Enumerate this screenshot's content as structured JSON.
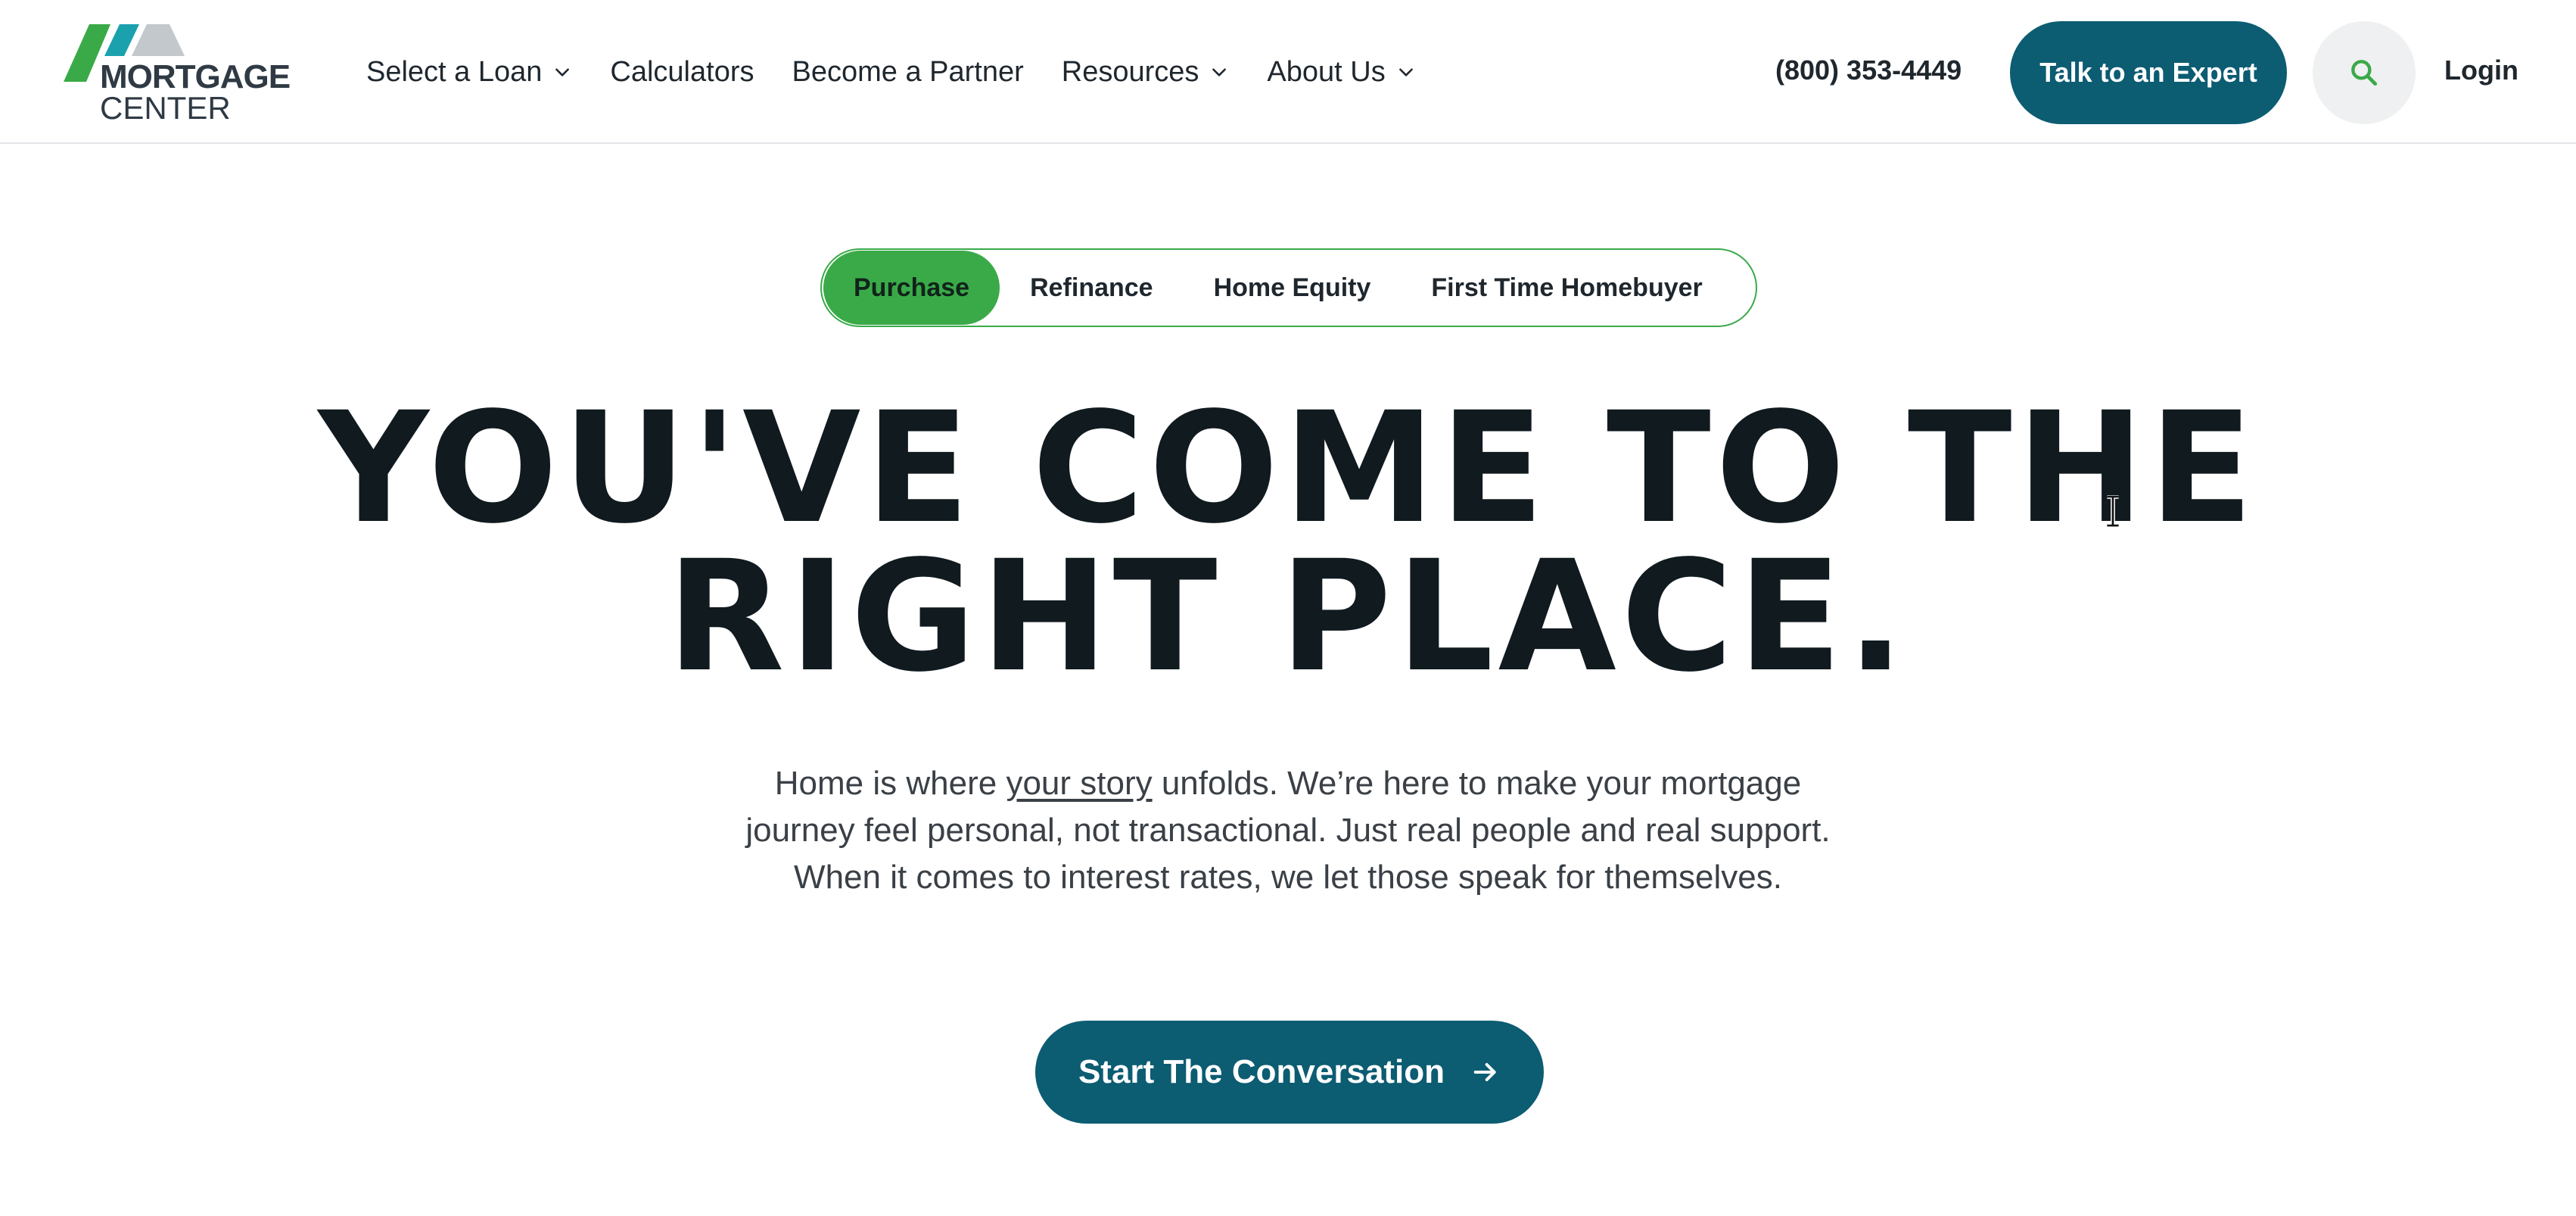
{
  "brand": {
    "logo_line1": "MORTGAGE",
    "logo_line2": "CENTER",
    "colors": {
      "primary": "#0c5c72",
      "accent_green": "#3aaa49",
      "logo_teal": "#1ba1ad",
      "logo_gray": "#c3c8cc"
    }
  },
  "nav": {
    "items": [
      {
        "label": "Select a Loan",
        "dropdown": true
      },
      {
        "label": "Calculators",
        "dropdown": false
      },
      {
        "label": "Become a Partner",
        "dropdown": false
      },
      {
        "label": "Resources",
        "dropdown": true
      },
      {
        "label": "About Us",
        "dropdown": true
      }
    ],
    "phone": "(800) 353-4449",
    "cta_label": "Talk to an Expert",
    "search_icon": "search-icon",
    "login_label": "Login"
  },
  "tabs": {
    "items": [
      {
        "label": "Purchase",
        "active": true
      },
      {
        "label": "Refinance",
        "active": false
      },
      {
        "label": "Home Equity",
        "active": false
      },
      {
        "label": "First Time Homebuyer",
        "active": false
      }
    ]
  },
  "hero": {
    "title_line1": "YOU'VE COME TO THE",
    "title_line2": "RIGHT PLACE.",
    "body_before": "Home is where ",
    "body_link": "your story",
    "body_after": " unfolds. We’re here to make your mortgage journey feel personal, not transactional. Just real people and real support. When it comes to interest rates, we let those speak for themselves.",
    "cta_label": "Start The Conversation",
    "cta_icon": "arrow-right-icon"
  }
}
